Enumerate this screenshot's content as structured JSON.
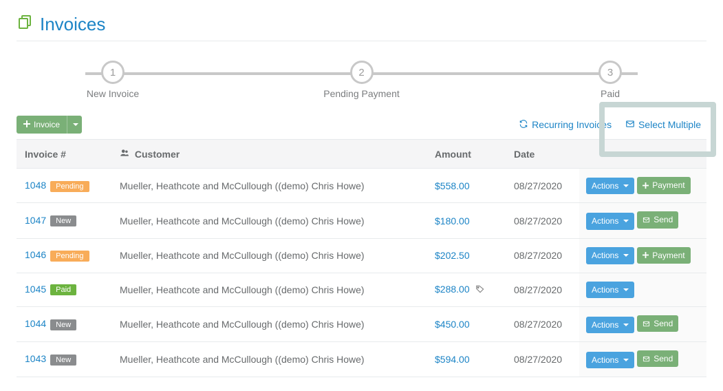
{
  "page": {
    "title": "Invoices"
  },
  "steps": [
    {
      "num": "1",
      "label": "New Invoice"
    },
    {
      "num": "2",
      "label": "Pending Payment"
    },
    {
      "num": "3",
      "label": "Paid"
    }
  ],
  "toolbar": {
    "invoice_btn": "Invoice",
    "recurring_link": "Recurring Invoices",
    "select_multiple_link": "Select Multiple"
  },
  "table": {
    "headers": {
      "invoice": "Invoice #",
      "customer": "Customer",
      "amount": "Amount",
      "date": "Date"
    },
    "action_labels": {
      "actions": "Actions",
      "payment": "Payment",
      "send": "Send"
    },
    "rows": [
      {
        "num": "1048",
        "status": "Pending",
        "status_class": "badge-pending",
        "customer": "Mueller, Heathcote and McCullough ((demo) Chris Howe)",
        "amount": "$558.00",
        "date": "08/27/2020",
        "secondary": "payment",
        "tag": false
      },
      {
        "num": "1047",
        "status": "New",
        "status_class": "badge-new",
        "customer": "Mueller, Heathcote and McCullough ((demo) Chris Howe)",
        "amount": "$180.00",
        "date": "08/27/2020",
        "secondary": "send",
        "tag": false
      },
      {
        "num": "1046",
        "status": "Pending",
        "status_class": "badge-pending",
        "customer": "Mueller, Heathcote and McCullough ((demo) Chris Howe)",
        "amount": "$202.50",
        "date": "08/27/2020",
        "secondary": "payment",
        "tag": false
      },
      {
        "num": "1045",
        "status": "Paid",
        "status_class": "badge-paid",
        "customer": "Mueller, Heathcote and McCullough ((demo) Chris Howe)",
        "amount": "$288.00",
        "date": "08/27/2020",
        "secondary": "none",
        "tag": true
      },
      {
        "num": "1044",
        "status": "New",
        "status_class": "badge-new",
        "customer": "Mueller, Heathcote and McCullough ((demo) Chris Howe)",
        "amount": "$450.00",
        "date": "08/27/2020",
        "secondary": "send",
        "tag": false
      },
      {
        "num": "1043",
        "status": "New",
        "status_class": "badge-new",
        "customer": "Mueller, Heathcote and McCullough ((demo) Chris Howe)",
        "amount": "$594.00",
        "date": "08/27/2020",
        "secondary": "send",
        "tag": false
      }
    ]
  }
}
